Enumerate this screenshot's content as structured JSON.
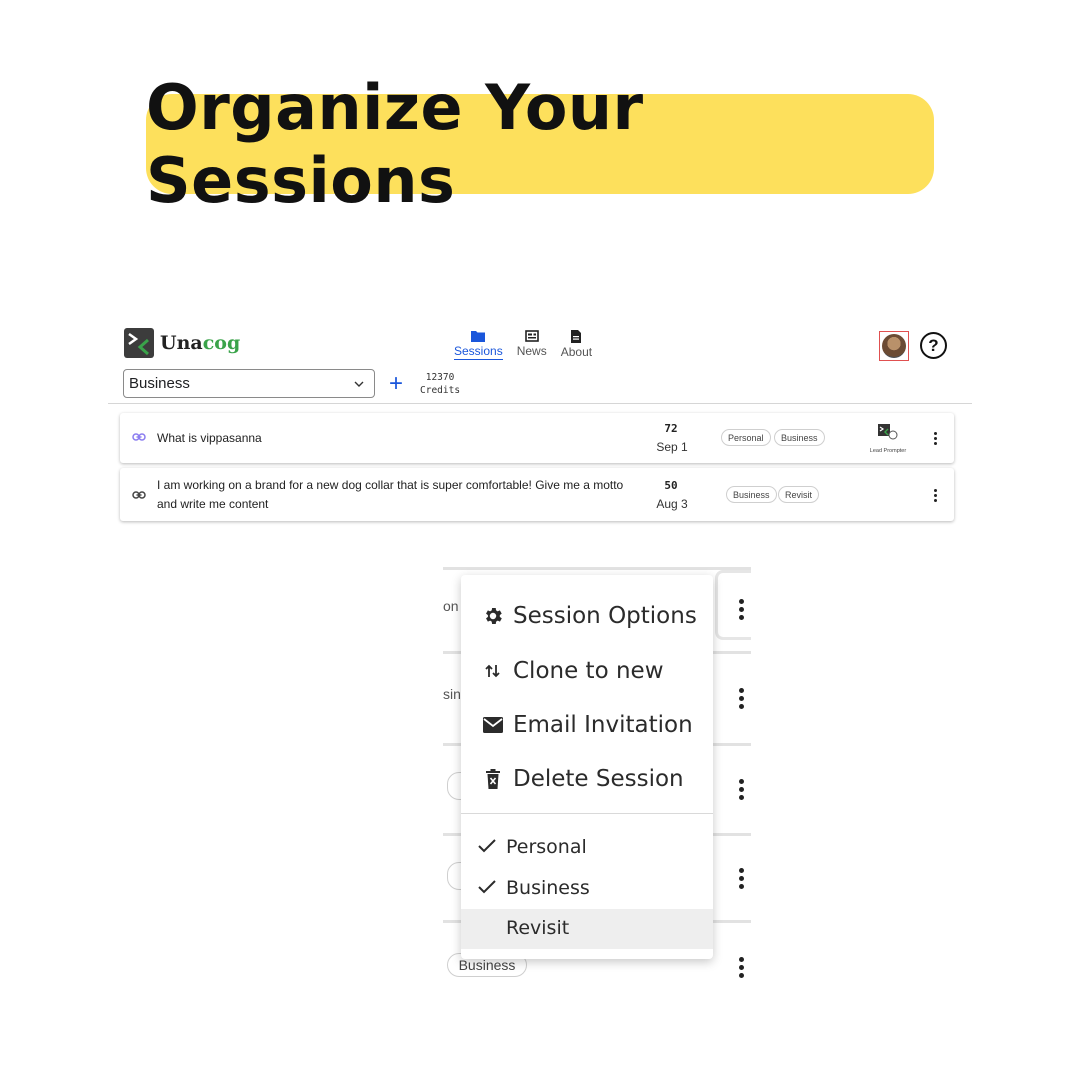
{
  "banner": {
    "title": "Organize Your Sessions"
  },
  "app": {
    "brand": {
      "name_prefix": "Una",
      "name_suffix": "cog"
    },
    "nav": [
      {
        "label": "Sessions",
        "icon": "folder-icon",
        "active": true
      },
      {
        "label": "News",
        "icon": "news-icon",
        "active": false
      },
      {
        "label": "About",
        "icon": "document-icon",
        "active": false
      }
    ],
    "filter": {
      "selected": "Business"
    },
    "credits": {
      "value": "12370",
      "label": "Credits"
    },
    "sessions": [
      {
        "title": "What is vippasanna",
        "count": "72",
        "date": "Sep 1",
        "tags": [
          "Personal",
          "Business"
        ],
        "owner_badge": "Lead Prompter",
        "link_color": "#8a7cf0"
      },
      {
        "title": "I am working on a brand for a new dog collar that is super comfortable! Give me a motto and write me content",
        "count": "50",
        "date": "Aug 3",
        "tags": [
          "Business",
          "Revisit"
        ],
        "link_color": "#444444"
      }
    ]
  },
  "zoom": {
    "background": {
      "fragments": [
        "on",
        "sin"
      ],
      "pill_label": "Business"
    },
    "menu": {
      "actions": [
        {
          "label": "Session Options",
          "icon": "gear-icon"
        },
        {
          "label": "Clone to new",
          "icon": "swap-arrows-icon"
        },
        {
          "label": "Email Invitation",
          "icon": "envelope-icon"
        },
        {
          "label": "Delete Session",
          "icon": "trash-icon"
        }
      ],
      "tags": [
        {
          "label": "Personal",
          "checked": true
        },
        {
          "label": "Business",
          "checked": true
        },
        {
          "label": "Revisit",
          "checked": false
        }
      ]
    }
  },
  "colors": {
    "banner": "#fde05c",
    "accent": "#1a56db",
    "brand_green": "#3aa34a"
  }
}
